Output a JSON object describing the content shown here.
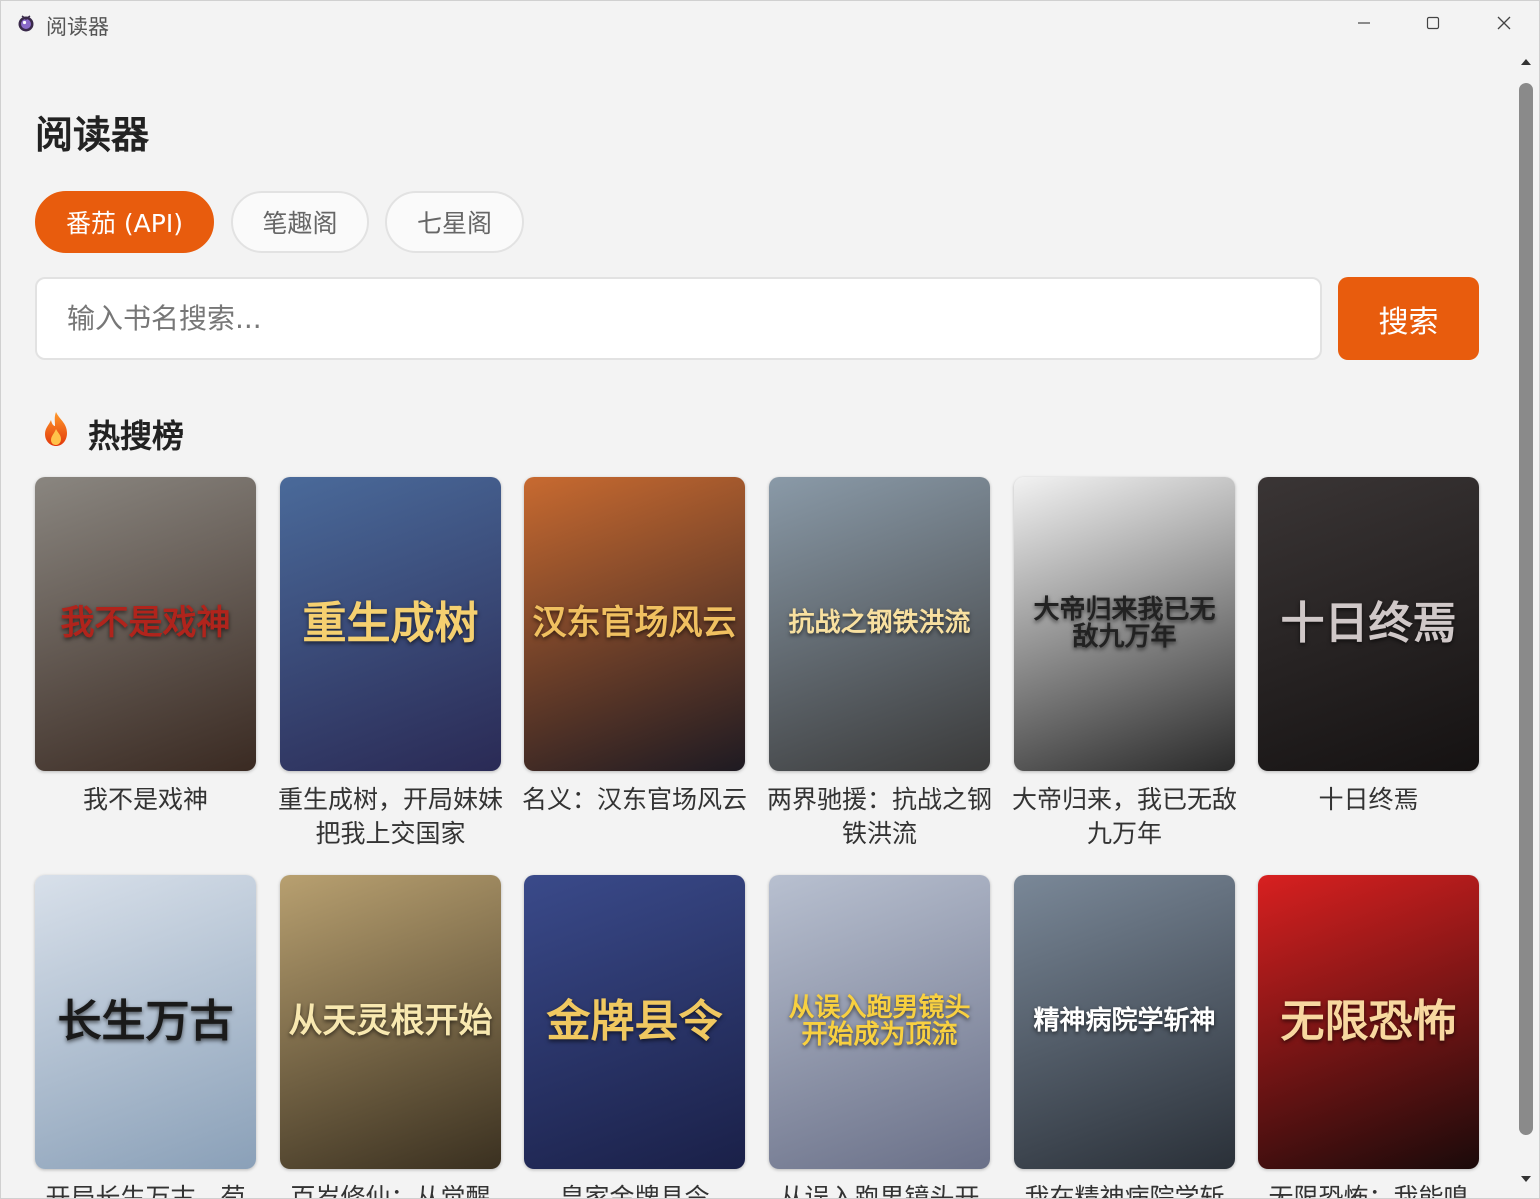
{
  "window": {
    "title": "阅读器",
    "minimize_glyph": "—",
    "maximize_glyph": "☐",
    "close_glyph": "✕",
    "app_icon": "app-logo-icon"
  },
  "page": {
    "title": "阅读器"
  },
  "tabs": [
    {
      "label": "番茄 (API)",
      "active": true
    },
    {
      "label": "笔趣阁",
      "active": false
    },
    {
      "label": "七星阁",
      "active": false
    }
  ],
  "search": {
    "placeholder": "输入书名搜索...",
    "value": "",
    "button_label": "搜索"
  },
  "hot": {
    "icon": "fire-icon",
    "title": "热搜榜"
  },
  "books": [
    {
      "title": "我不是戏神",
      "cover_text": "我不是戏神",
      "bg1": "#8a8680",
      "bg2": "#3a2a22",
      "fg": "#b0241c"
    },
    {
      "title": "重生成树，开局妹妹把我上交国家",
      "cover_text": "重生成树",
      "bg1": "#4a6a9a",
      "bg2": "#2a2a55",
      "fg": "#f5d070"
    },
    {
      "title": "名义：汉东官场风云",
      "cover_text": "汉东官场风云",
      "bg1": "#c86a30",
      "bg2": "#1e1a22",
      "fg": "#f0c060"
    },
    {
      "title": "两界驰援：抗战之钢铁洪流",
      "cover_text": "抗战之钢铁洪流",
      "bg1": "#8a9aa8",
      "bg2": "#3a3a3a",
      "fg": "#f8e0a0"
    },
    {
      "title": "大帝归来，我已无敌九万年",
      "cover_text": "大帝归来我已无敌九万年",
      "bg1": "#f2f2f2",
      "bg2": "#2a2a2a",
      "fg": "#222222"
    },
    {
      "title": "十日终焉",
      "cover_text": "十日终焉",
      "bg1": "#3a3535",
      "bg2": "#151212",
      "fg": "#d0c8c8"
    },
    {
      "title": "开局长生万古，苟到天荒地老",
      "cover_text": "长生万古",
      "bg1": "#d8e0ea",
      "bg2": "#8aa0b8",
      "fg": "#1a1a1a"
    },
    {
      "title": "百岁修仙：从觉醒灵根开始",
      "cover_text": "从天灵根开始",
      "bg1": "#b8a070",
      "bg2": "#3a3020",
      "fg": "#f8e8b0"
    },
    {
      "title": "皇家金牌县令",
      "cover_text": "金牌县令",
      "bg1": "#3a4a8a",
      "bg2": "#1a2048",
      "fg": "#f0c860"
    },
    {
      "title": "从误入跑男镜头开始成为顶流",
      "cover_text": "从误入跑男镜头开始成为顶流",
      "bg1": "#b8c0d0",
      "bg2": "#6a7088",
      "fg": "#f8d040"
    },
    {
      "title": "我在精神病院学斩神",
      "cover_text": "精神病院学斩神",
      "bg1": "#7a8898",
      "bg2": "#2a3038",
      "fg": "#ffffff"
    },
    {
      "title": "无限恐怖：我能嗅到鬼味",
      "cover_text": "无限恐怖",
      "bg1": "#d82020",
      "bg2": "#1a0a0a",
      "fg": "#f8d8a0"
    }
  ],
  "row2_titles_partial": [
    "开局长生万古，苟",
    "百岁修仙：从觉醒",
    "皇家金牌县令",
    "从误入跑男镜头开",
    "我在精神病院学斩",
    "无限恐怖：我能嗅"
  ]
}
